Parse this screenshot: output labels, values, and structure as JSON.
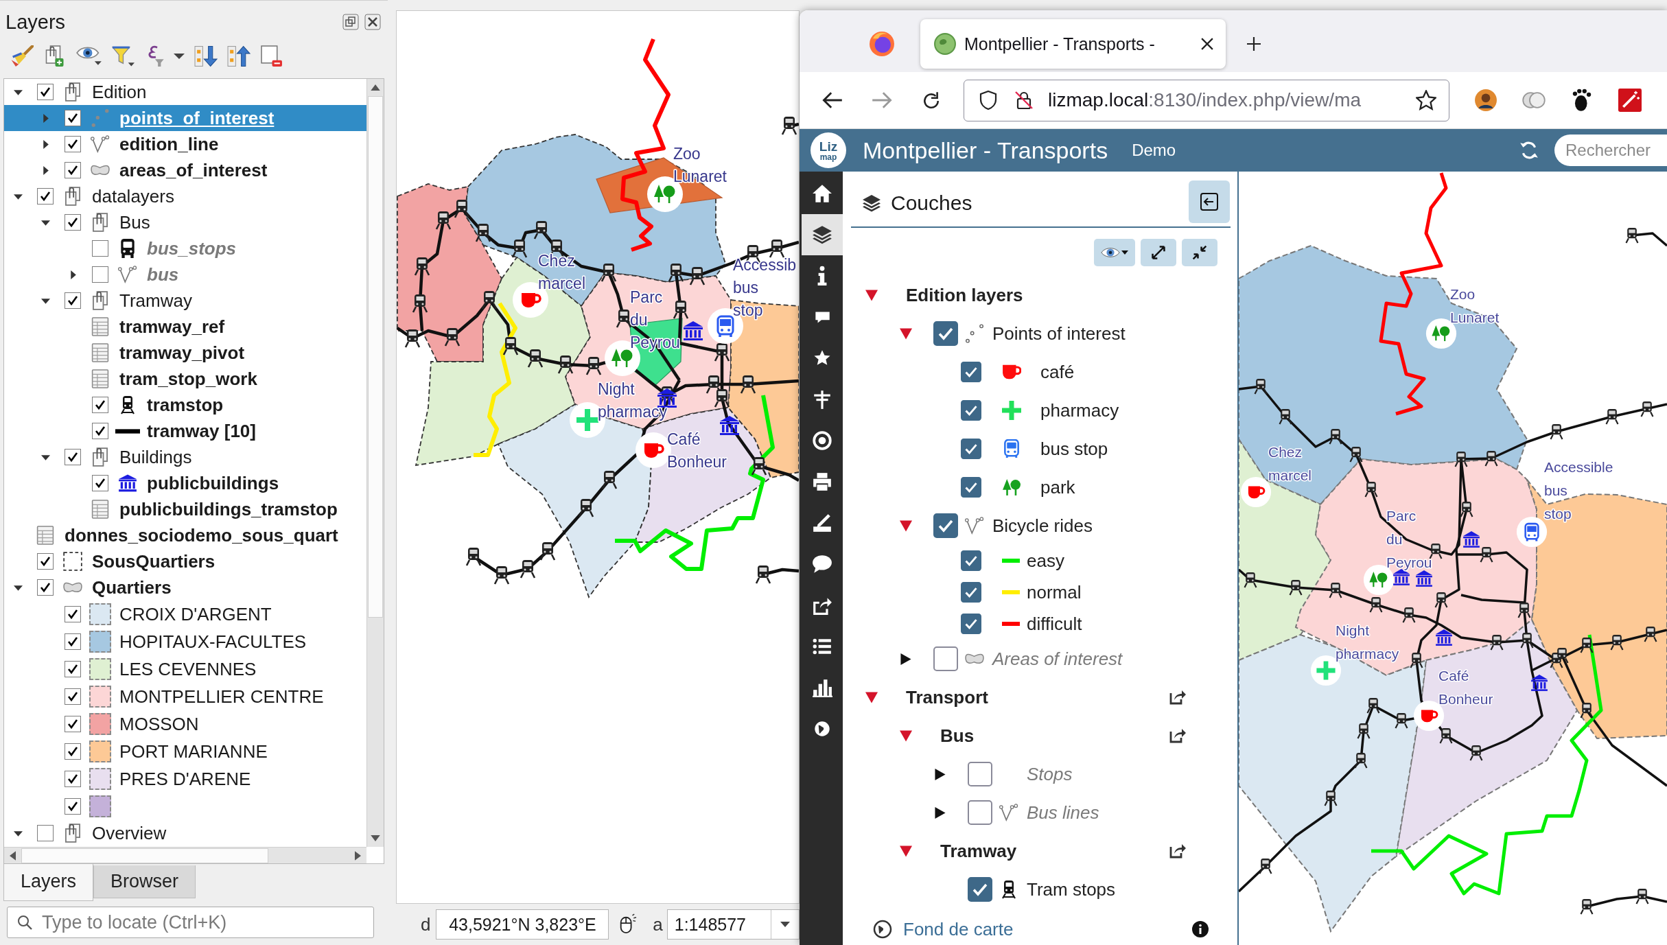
{
  "qgis": {
    "layers_panel": {
      "title": "Layers",
      "tree": [
        {
          "label": "Edition",
          "kind": "group",
          "checked": true,
          "expanded": true,
          "selected": false,
          "children": [
            {
              "label": "points_of_interest",
              "kind": "point",
              "checked": true,
              "expanded": false,
              "selected": true
            },
            {
              "label": "edition_line",
              "kind": "line",
              "checked": true,
              "expanded": false,
              "selected": false
            },
            {
              "label": "areas_of_interest",
              "kind": "polygon",
              "checked": true,
              "expanded": false,
              "selected": false
            }
          ]
        },
        {
          "label": "datalayers",
          "kind": "group",
          "checked": true,
          "expanded": true,
          "selected": false,
          "children": [
            {
              "label": "Bus",
              "kind": "group",
              "checked": true,
              "expanded": true,
              "selected": false,
              "children": [
                {
                  "label": "bus_stops",
                  "kind": "bus",
                  "checked": false,
                  "selected": false
                },
                {
                  "label": "bus",
                  "kind": "line",
                  "checked": false,
                  "expanded": false,
                  "selected": false
                }
              ]
            },
            {
              "label": "Tramway",
              "kind": "group",
              "checked": true,
              "expanded": true,
              "selected": false,
              "children": [
                {
                  "label": "tramway_ref",
                  "kind": "table",
                  "selected": false
                },
                {
                  "label": "tramway_pivot",
                  "kind": "table",
                  "selected": false
                },
                {
                  "label": "tram_stop_work",
                  "kind": "table",
                  "selected": false
                },
                {
                  "label": "tramstop",
                  "kind": "tram",
                  "checked": true,
                  "selected": false
                },
                {
                  "label": "tramway [10]",
                  "kind": "solidline",
                  "checked": true,
                  "selected": false
                }
              ]
            },
            {
              "label": "Buildings",
              "kind": "group",
              "checked": true,
              "expanded": true,
              "selected": false,
              "children": [
                {
                  "label": "publicbuildings",
                  "kind": "building",
                  "checked": true,
                  "selected": false
                },
                {
                  "label": "publicbuildings_tramstop",
                  "kind": "table",
                  "selected": false
                }
              ]
            }
          ]
        },
        {
          "label": "donnes_sociodemo_sous_quart",
          "kind": "table",
          "selected": false
        },
        {
          "label": "SousQuartiers",
          "kind": "outline",
          "checked": true,
          "selected": false
        },
        {
          "label": "Quartiers",
          "kind": "polygon",
          "checked": true,
          "expanded": true,
          "selected": false,
          "children": [
            {
              "label": "CROIX D'ARGENT",
              "kind": "swatch",
              "checked": true,
              "selected": false,
              "color": "#dbe8f2"
            },
            {
              "label": "HOPITAUX-FACULTES",
              "kind": "swatch",
              "checked": true,
              "selected": false,
              "color": "#a6c8e1"
            },
            {
              "label": "LES CEVENNES",
              "kind": "swatch",
              "checked": true,
              "selected": false,
              "color": "#dff0d2"
            },
            {
              "label": "MONTPELLIER CENTRE",
              "kind": "swatch",
              "checked": true,
              "selected": false,
              "color": "#fcd6d6"
            },
            {
              "label": "MOSSON",
              "kind": "swatch",
              "checked": true,
              "selected": false,
              "color": "#f2a3a3"
            },
            {
              "label": "PORT MARIANNE",
              "kind": "swatch",
              "checked": true,
              "selected": false,
              "color": "#fdc996"
            },
            {
              "label": "PRES D'ARENE",
              "kind": "swatch",
              "checked": true,
              "selected": false,
              "color": "#e8dfef"
            },
            {
              "kind": "swatch",
              "checked": true,
              "selected": false,
              "color": "#c4b1d9"
            }
          ]
        },
        {
          "label": "Overview",
          "kind": "group",
          "checked": false,
          "expanded": true,
          "selected": false
        }
      ]
    },
    "panel_tabs": [
      {
        "label": "Layers",
        "selected": true
      },
      {
        "label": "Browser",
        "selected": false
      }
    ],
    "locator": {
      "placeholder": "Type to locate (Ctrl+K)"
    },
    "map": {
      "labels": [
        {
          "lines": [
            "Zoo",
            "Lunaret"
          ]
        },
        {
          "lines": [
            "Chez",
            "marcel"
          ]
        },
        {
          "lines": [
            "Parc",
            "du",
            "Peyrou"
          ]
        },
        {
          "lines": [
            "Accessib",
            "bus",
            "stop"
          ]
        },
        {
          "lines": [
            "Night",
            "pharmacy"
          ]
        },
        {
          "lines": [
            "Café",
            "Bonheur"
          ]
        }
      ]
    },
    "status_bar": {
      "coordinate_label": "d",
      "coordinate": "43,5921°N 3,823°E",
      "scale_label": "a",
      "scale": "1:148577"
    }
  },
  "browser": {
    "tabs": [
      {
        "title": "Montpellier - Transports -",
        "selected": true
      }
    ],
    "address": {
      "host": "lizmap.local",
      "path": ":8130/index.php/view/ma"
    }
  },
  "lizmap": {
    "header": {
      "logo_lines": [
        "Liz",
        "map"
      ],
      "title": "Montpellier - Transports",
      "subtitle": "Demo",
      "search_placeholder": "Rechercher"
    },
    "sidebar": [
      {
        "kind": "home",
        "selected": false
      },
      {
        "kind": "layers",
        "selected": true
      },
      {
        "kind": "info",
        "selected": false
      },
      {
        "kind": "comment",
        "selected": false
      },
      {
        "kind": "star",
        "selected": false
      },
      {
        "kind": "signpost",
        "selected": false
      },
      {
        "kind": "target",
        "selected": false
      },
      {
        "kind": "print",
        "selected": false
      },
      {
        "kind": "measure",
        "selected": false
      },
      {
        "kind": "bubble",
        "selected": false
      },
      {
        "kind": "share",
        "selected": false
      },
      {
        "kind": "list",
        "selected": false
      },
      {
        "kind": "chart",
        "selected": false
      },
      {
        "kind": "globe",
        "selected": false
      }
    ],
    "panel": {
      "title": "Couches",
      "tree": [
        {
          "label": "Edition layers",
          "kind": "group",
          "expanded": true,
          "children": [
            {
              "label": "Points of interest",
              "kind": "point",
              "checked": true,
              "expanded": true,
              "children": [
                {
                  "label": "café",
                  "kind": "cafe",
                  "checked": true
                },
                {
                  "label": "pharmacy",
                  "kind": "pharmacy",
                  "checked": true
                },
                {
                  "label": "bus stop",
                  "kind": "busstop",
                  "checked": true
                },
                {
                  "label": "park",
                  "kind": "park",
                  "checked": true
                }
              ]
            },
            {
              "label": "Bicycle rides",
              "kind": "line",
              "checked": true,
              "expanded": true,
              "children": [
                {
                  "label": "easy",
                  "kind": "stroke",
                  "checked": true,
                  "color": "#00ee00"
                },
                {
                  "label": "normal",
                  "kind": "stroke",
                  "checked": true,
                  "color": "#ffee00"
                },
                {
                  "label": "difficult",
                  "kind": "stroke",
                  "checked": true,
                  "color": "#ff0000"
                }
              ]
            },
            {
              "label": "Areas of interest",
              "kind": "polygon",
              "checked": false,
              "expanded": false
            }
          ]
        },
        {
          "label": "Transport",
          "kind": "actiongroup",
          "expanded": true,
          "children": [
            {
              "label": "Bus",
              "kind": "actiongroup",
              "expanded": true,
              "children": [
                {
                  "label": "Stops",
                  "kind": "blank",
                  "checked": false,
                  "expanded": false
                },
                {
                  "label": "Bus lines",
                  "kind": "line",
                  "checked": false,
                  "expanded": false
                }
              ]
            },
            {
              "label": "Tramway",
              "kind": "actiongroup",
              "expanded": true,
              "children": [
                {
                  "label": "Tram stops",
                  "kind": "tram",
                  "checked": true
                }
              ]
            }
          ]
        }
      ]
    },
    "baselayers": {
      "title": "Fond de carte"
    },
    "map": {
      "labels": [
        {
          "lines": [
            "Zoo",
            "Lunaret"
          ]
        },
        {
          "lines": [
            "Chez",
            "marcel"
          ]
        },
        {
          "lines": [
            "Parc",
            "du",
            "Peyrou"
          ]
        },
        {
          "lines": [
            "Accessible",
            "bus",
            "stop"
          ]
        },
        {
          "lines": [
            "Night",
            "pharmacy"
          ]
        },
        {
          "lines": [
            "Café",
            "Bonheur"
          ]
        }
      ]
    }
  }
}
